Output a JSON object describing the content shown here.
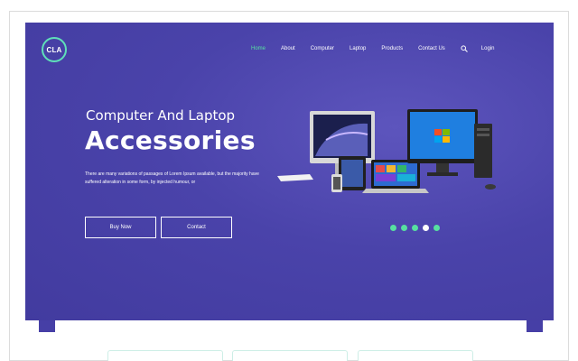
{
  "logo": {
    "text": "CLA"
  },
  "nav": {
    "items": [
      {
        "label": "Home"
      },
      {
        "label": "About"
      },
      {
        "label": "Computer"
      },
      {
        "label": "Laptop"
      },
      {
        "label": "Products"
      },
      {
        "label": "Contact Us"
      }
    ],
    "search_icon": "search-icon",
    "login": "Login"
  },
  "hero": {
    "subtitle": "Computer And Laptop",
    "title": "Accessories",
    "description": "There are many variations of passages of Lorem Ipsum available, but the majority have suffered alteration in some form, by injected humour, or",
    "buy_button": "Buy Now",
    "contact_button": "Contact"
  },
  "carousel": {
    "slide_count": 5,
    "active_index": 3
  },
  "colors": {
    "hero_bg": "#4a43aa",
    "accent": "#57e0a0",
    "text": "#ffffff"
  }
}
